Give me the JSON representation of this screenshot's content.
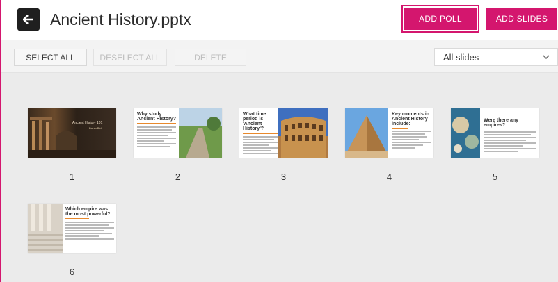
{
  "header": {
    "title": "Ancient History.pptx",
    "add_poll_label": "ADD POLL",
    "add_slides_label": "ADD SLIDES"
  },
  "toolbar": {
    "select_all": "SELECT ALL",
    "deselect_all": "DESELECT ALL",
    "delete": "DELETE",
    "filter_value": "All slides"
  },
  "slides": [
    {
      "number": "1",
      "title": "Ancient History 101",
      "subtitle": "Durso Bldt"
    },
    {
      "number": "2",
      "title": "Why study Ancient History?"
    },
    {
      "number": "3",
      "title": "What time period is 'Ancient History'?"
    },
    {
      "number": "4",
      "title": "Key moments in Ancient History include:"
    },
    {
      "number": "5",
      "title": "Were there any empires?"
    },
    {
      "number": "6",
      "title": "Which empire was the most powerful?"
    }
  ],
  "colors": {
    "accent": "#d4166e",
    "header_bg": "#ffffff",
    "grid_bg": "#ebebeb"
  }
}
